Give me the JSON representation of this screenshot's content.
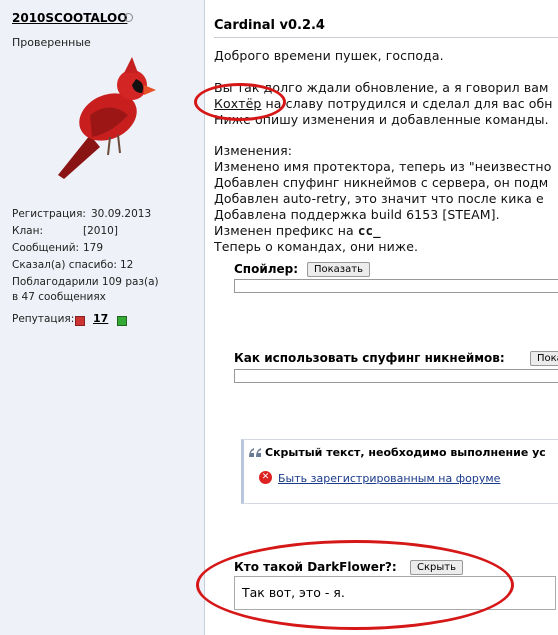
{
  "user": {
    "name": "2010SCOOTALOO",
    "title": "Проверенные",
    "stats": [
      {
        "label": "Регистрация:",
        "value": "30.09.2013"
      },
      {
        "label": "Клан:",
        "value": "[2010]"
      },
      {
        "label": "Сообщений:",
        "value": "179"
      },
      {
        "label": "Сказал(а) спасибо:",
        "value": "12"
      }
    ],
    "thanked_line1": "Поблагодарили 109 раз(а)",
    "thanked_line2": "в 47 сообщениях",
    "reputation_label": "Репутация:",
    "reputation_value": "17"
  },
  "post": {
    "title": "Cardinal v0.2.4",
    "greeting": "Доброго времени пушек, господа.",
    "line1": "Вы так долго ждали обновление, а я говорил вам",
    "line2_link": "Кохтёр",
    "line2_rest": " на славу потрудился и сделал для вас обн",
    "line3": "Ниже опишу изменения и добавленные команды.",
    "changes_header": "Изменения:",
    "changes": [
      "Изменено имя протектора, теперь из \"неизвестно",
      "Добавлен спуфинг никнеймов с сервера, он подм",
      "Добавлен auto-retry, это значит что после кика е",
      "Добавлена поддержка build 6153 [STEAM].",
      "Изменен префикс на "
    ],
    "prefix_code": "cc_",
    "commands_line": "Теперь о командах, они ниже."
  },
  "spoiler1": {
    "label": "Спойлер:",
    "button": "Показать"
  },
  "spoiler2": {
    "label": "Как использовать спуфинг никнеймов:",
    "button": "Пока"
  },
  "hidden": {
    "title": "Скрытый текст, необходимо выполнение ус",
    "link": "Быть зарегистрированным на форуме"
  },
  "spoiler3": {
    "label": "Кто такой DarkFlower?:",
    "button": "Скрыть",
    "content": "Так вот, это - я."
  },
  "colors": {
    "annotation": "#d51717",
    "sidebar_bg": "#eef1f7",
    "link": "#1a3a8a"
  }
}
